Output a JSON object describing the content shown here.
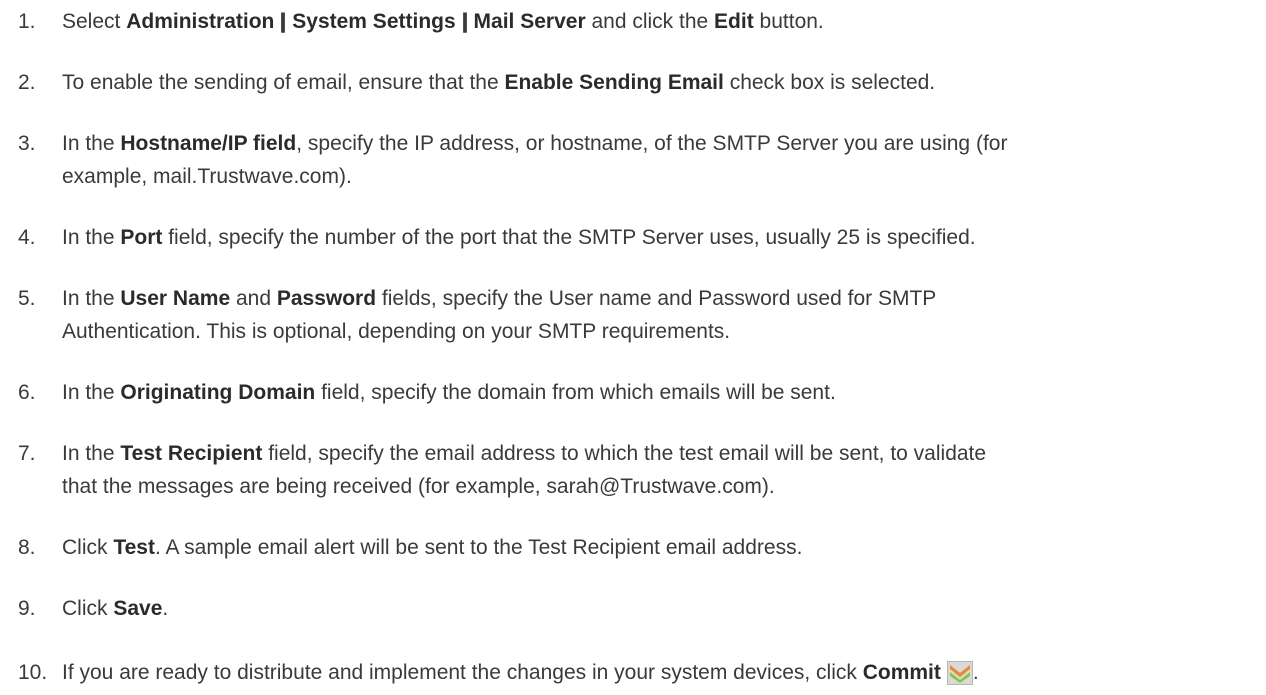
{
  "steps": [
    {
      "number": "1.",
      "parts": [
        {
          "t": "Select "
        },
        {
          "b": "Administration"
        },
        {
          "sep": "|"
        },
        {
          "b": "System Settings"
        },
        {
          "sep": "|"
        },
        {
          "b": "Mail Server"
        },
        {
          "t": " and click the "
        },
        {
          "b": "Edit"
        },
        {
          "t": " button."
        }
      ]
    },
    {
      "number": "2.",
      "parts": [
        {
          "t": "To enable the sending of email, ensure that the "
        },
        {
          "b": "Enable Sending Email"
        },
        {
          "t": " check box is selected."
        }
      ]
    },
    {
      "number": "3.",
      "parts": [
        {
          "t": "In the "
        },
        {
          "b": "Hostname/IP field"
        },
        {
          "t": ", specify the IP address, or hostname, of the SMTP Server you are using (for"
        },
        {
          "br": true
        },
        {
          "t": "example, mail.Trustwave.com)."
        }
      ]
    },
    {
      "number": "4.",
      "parts": [
        {
          "t": "In the "
        },
        {
          "b": "Port"
        },
        {
          "t": " field, specify the number of the port that the SMTP Server uses, usually 25 is specified."
        }
      ]
    },
    {
      "number": "5.",
      "parts": [
        {
          "t": "In the "
        },
        {
          "b": "User Name"
        },
        {
          "t": " and "
        },
        {
          "b": "Password"
        },
        {
          "t": " fields, specify the User name and Password used for SMTP"
        },
        {
          "br": true
        },
        {
          "t": "Authentication. This is optional, depending on your SMTP requirements."
        }
      ]
    },
    {
      "number": "6.",
      "parts": [
        {
          "t": "In the "
        },
        {
          "b": "Originating Domain"
        },
        {
          "t": " field, specify the domain from which emails will be sent."
        }
      ]
    },
    {
      "number": "7.",
      "parts": [
        {
          "t": "In the "
        },
        {
          "b": "Test Recipient"
        },
        {
          "t": " field, specify the email address to which the test email will be sent, to validate"
        },
        {
          "br": true
        },
        {
          "t": "that the messages are being received (for example, sarah@Trustwave.com)."
        }
      ]
    },
    {
      "number": "8.",
      "parts": [
        {
          "t": "Click "
        },
        {
          "b": "Test"
        },
        {
          "t": ". A sample email alert will be sent to the Test Recipient email address."
        }
      ]
    },
    {
      "number": "9.",
      "parts": [
        {
          "t": "Click "
        },
        {
          "b": "Save"
        },
        {
          "t": "."
        }
      ]
    },
    {
      "number": "10.",
      "parts": [
        {
          "t": "If you are ready to distribute and implement the changes in your system devices, click "
        },
        {
          "b": "Commit"
        },
        {
          "icon": "commit-icon"
        },
        {
          "t": "."
        }
      ]
    }
  ],
  "colors": {
    "text": "#3a3a3a",
    "icon_orange": "#e8892a",
    "icon_green": "#8cc63f"
  }
}
